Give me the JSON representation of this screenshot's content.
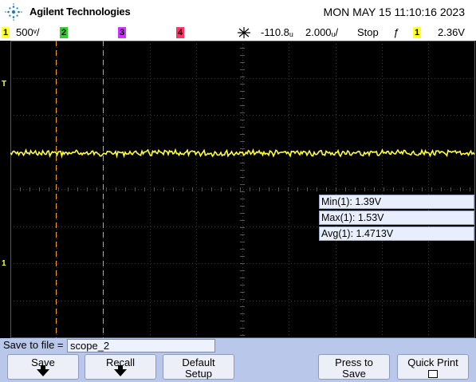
{
  "header": {
    "brand": "Agilent Technologies",
    "datetime": "MON MAY 15 11:10:16 2023"
  },
  "status": {
    "ch1_num": "1",
    "ch1_scale": "500ᵛ/",
    "ch2_num": "2",
    "ch3_num": "3",
    "ch4_num": "4",
    "trig_pos": "-110.8ᵤ",
    "timebase": "2.000ᵤ/",
    "run_state": "Stop",
    "trig_edge": "ƒ",
    "trig_src": "1",
    "trig_level": "2.36V"
  },
  "markers": {
    "trigger": "T",
    "ch1": "1"
  },
  "measurements": [
    {
      "label": "Min(1): 1.39V"
    },
    {
      "label": "Max(1): 1.53V"
    },
    {
      "label": "Avg(1): 1.4713V"
    }
  ],
  "save": {
    "label": "Save to file =",
    "filename": "scope_2"
  },
  "softkeys": {
    "save": "Save",
    "recall": "Recall",
    "default_1": "Default",
    "default_2": "Setup",
    "press_1": "Press to",
    "press_2": "Save",
    "quick_print": "Quick Print"
  },
  "colors": {
    "ch1": "#ffff33",
    "ch2": "#33cc33",
    "ch3": "#cc33ff",
    "ch4": "#ff3366",
    "cursor": "#ff9922",
    "softkey_bg": "#b9c7ea"
  }
}
